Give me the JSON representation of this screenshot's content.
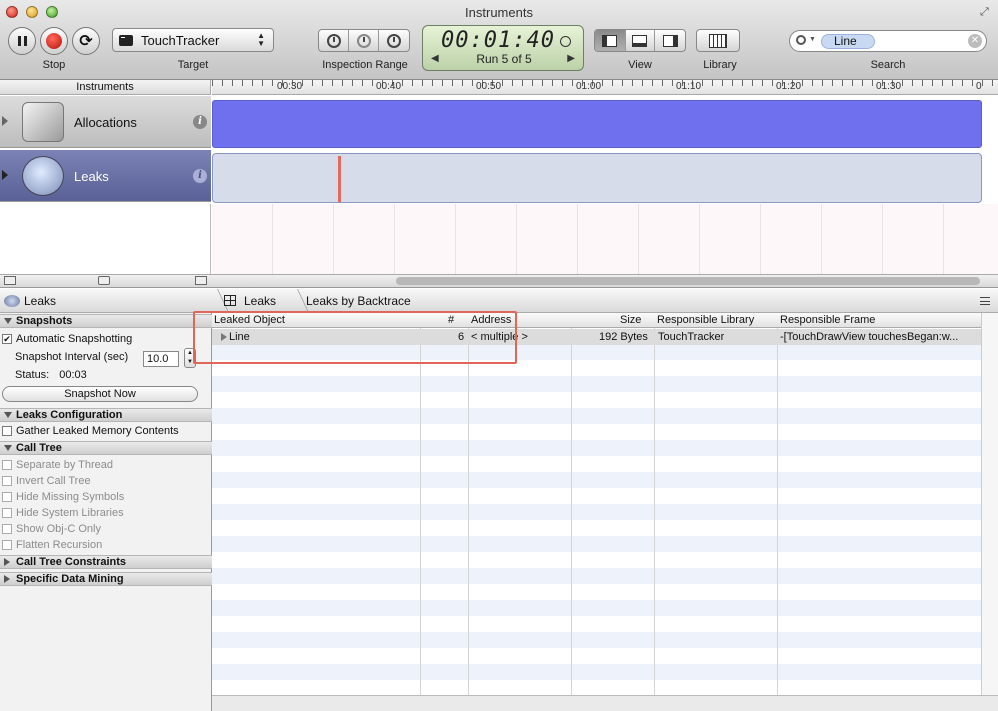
{
  "window": {
    "title": "Instruments"
  },
  "toolbar": {
    "stop_label": "Stop",
    "target_label": "Target",
    "target_value": "TouchTracker",
    "inspection_range_label": "Inspection Range",
    "timer": "00:01:40",
    "run_text": "Run 5 of 5",
    "view_label": "View",
    "library_label": "Library",
    "search_label": "Search",
    "search_token": "Line"
  },
  "timeline": {
    "header": "Instruments",
    "ticks": [
      "00:30",
      "00:40",
      "00:50",
      "01:00",
      "01:10",
      "01:20",
      "01:30",
      "0"
    ],
    "instruments": [
      {
        "name": "Allocations",
        "icon": "allocations-icon"
      },
      {
        "name": "Leaks",
        "icon": "leaks-icon"
      }
    ]
  },
  "sidebar": {
    "title": "Leaks",
    "snapshots_header": "Snapshots",
    "auto_snapshot": "Automatic Snapshotting",
    "auto_snapshot_checked": true,
    "interval_label": "Snapshot Interval (sec)",
    "interval_value": "10.0",
    "status_label": "Status:",
    "status_value": "00:03",
    "snapshot_now": "Snapshot Now",
    "leaks_config_header": "Leaks Configuration",
    "gather_contents": "Gather Leaked Memory Contents",
    "call_tree_header": "Call Tree",
    "call_tree_options": [
      "Separate by Thread",
      "Invert Call Tree",
      "Hide Missing Symbols",
      "Hide System Libraries",
      "Show Obj-C Only",
      "Flatten Recursion"
    ],
    "constraints_header": "Call Tree Constraints",
    "data_mining_header": "Specific Data Mining"
  },
  "detail": {
    "breadcrumb": [
      "Leaks",
      "Leaks by Backtrace"
    ],
    "columns": [
      "Leaked Object",
      "#",
      "Address",
      "Size",
      "Responsible Library",
      "Responsible Frame"
    ],
    "rows": [
      {
        "object": "Line",
        "count": "6",
        "address": "< multiple >",
        "size": "192 Bytes",
        "library": "TouchTracker",
        "frame": "-[TouchDrawView touchesBegan:w..."
      }
    ]
  },
  "colors": {
    "allocations_track": "#6e70ee",
    "leaks_track": "#d6dcea",
    "leak_marker": "#e46a5e",
    "annotation_box": "#e0665a"
  }
}
